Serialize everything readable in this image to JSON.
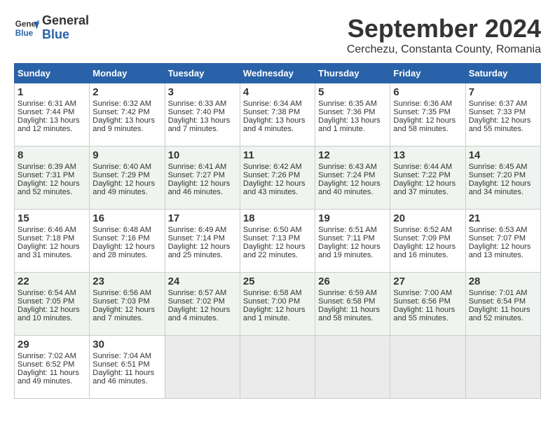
{
  "header": {
    "logo_line1": "General",
    "logo_line2": "Blue",
    "month": "September 2024",
    "location": "Cerchezu, Constanta County, Romania"
  },
  "weekdays": [
    "Sunday",
    "Monday",
    "Tuesday",
    "Wednesday",
    "Thursday",
    "Friday",
    "Saturday"
  ],
  "weeks": [
    [
      {
        "day": "1",
        "sunrise": "Sunrise: 6:31 AM",
        "sunset": "Sunset: 7:44 PM",
        "daylight": "Daylight: 13 hours and 12 minutes."
      },
      {
        "day": "2",
        "sunrise": "Sunrise: 6:32 AM",
        "sunset": "Sunset: 7:42 PM",
        "daylight": "Daylight: 13 hours and 9 minutes."
      },
      {
        "day": "3",
        "sunrise": "Sunrise: 6:33 AM",
        "sunset": "Sunset: 7:40 PM",
        "daylight": "Daylight: 13 hours and 7 minutes."
      },
      {
        "day": "4",
        "sunrise": "Sunrise: 6:34 AM",
        "sunset": "Sunset: 7:38 PM",
        "daylight": "Daylight: 13 hours and 4 minutes."
      },
      {
        "day": "5",
        "sunrise": "Sunrise: 6:35 AM",
        "sunset": "Sunset: 7:36 PM",
        "daylight": "Daylight: 13 hours and 1 minute."
      },
      {
        "day": "6",
        "sunrise": "Sunrise: 6:36 AM",
        "sunset": "Sunset: 7:35 PM",
        "daylight": "Daylight: 12 hours and 58 minutes."
      },
      {
        "day": "7",
        "sunrise": "Sunrise: 6:37 AM",
        "sunset": "Sunset: 7:33 PM",
        "daylight": "Daylight: 12 hours and 55 minutes."
      }
    ],
    [
      {
        "day": "8",
        "sunrise": "Sunrise: 6:39 AM",
        "sunset": "Sunset: 7:31 PM",
        "daylight": "Daylight: 12 hours and 52 minutes."
      },
      {
        "day": "9",
        "sunrise": "Sunrise: 6:40 AM",
        "sunset": "Sunset: 7:29 PM",
        "daylight": "Daylight: 12 hours and 49 minutes."
      },
      {
        "day": "10",
        "sunrise": "Sunrise: 6:41 AM",
        "sunset": "Sunset: 7:27 PM",
        "daylight": "Daylight: 12 hours and 46 minutes."
      },
      {
        "day": "11",
        "sunrise": "Sunrise: 6:42 AM",
        "sunset": "Sunset: 7:26 PM",
        "daylight": "Daylight: 12 hours and 43 minutes."
      },
      {
        "day": "12",
        "sunrise": "Sunrise: 6:43 AM",
        "sunset": "Sunset: 7:24 PM",
        "daylight": "Daylight: 12 hours and 40 minutes."
      },
      {
        "day": "13",
        "sunrise": "Sunrise: 6:44 AM",
        "sunset": "Sunset: 7:22 PM",
        "daylight": "Daylight: 12 hours and 37 minutes."
      },
      {
        "day": "14",
        "sunrise": "Sunrise: 6:45 AM",
        "sunset": "Sunset: 7:20 PM",
        "daylight": "Daylight: 12 hours and 34 minutes."
      }
    ],
    [
      {
        "day": "15",
        "sunrise": "Sunrise: 6:46 AM",
        "sunset": "Sunset: 7:18 PM",
        "daylight": "Daylight: 12 hours and 31 minutes."
      },
      {
        "day": "16",
        "sunrise": "Sunrise: 6:48 AM",
        "sunset": "Sunset: 7:16 PM",
        "daylight": "Daylight: 12 hours and 28 minutes."
      },
      {
        "day": "17",
        "sunrise": "Sunrise: 6:49 AM",
        "sunset": "Sunset: 7:14 PM",
        "daylight": "Daylight: 12 hours and 25 minutes."
      },
      {
        "day": "18",
        "sunrise": "Sunrise: 6:50 AM",
        "sunset": "Sunset: 7:13 PM",
        "daylight": "Daylight: 12 hours and 22 minutes."
      },
      {
        "day": "19",
        "sunrise": "Sunrise: 6:51 AM",
        "sunset": "Sunset: 7:11 PM",
        "daylight": "Daylight: 12 hours and 19 minutes."
      },
      {
        "day": "20",
        "sunrise": "Sunrise: 6:52 AM",
        "sunset": "Sunset: 7:09 PM",
        "daylight": "Daylight: 12 hours and 16 minutes."
      },
      {
        "day": "21",
        "sunrise": "Sunrise: 6:53 AM",
        "sunset": "Sunset: 7:07 PM",
        "daylight": "Daylight: 12 hours and 13 minutes."
      }
    ],
    [
      {
        "day": "22",
        "sunrise": "Sunrise: 6:54 AM",
        "sunset": "Sunset: 7:05 PM",
        "daylight": "Daylight: 12 hours and 10 minutes."
      },
      {
        "day": "23",
        "sunrise": "Sunrise: 6:56 AM",
        "sunset": "Sunset: 7:03 PM",
        "daylight": "Daylight: 12 hours and 7 minutes."
      },
      {
        "day": "24",
        "sunrise": "Sunrise: 6:57 AM",
        "sunset": "Sunset: 7:02 PM",
        "daylight": "Daylight: 12 hours and 4 minutes."
      },
      {
        "day": "25",
        "sunrise": "Sunrise: 6:58 AM",
        "sunset": "Sunset: 7:00 PM",
        "daylight": "Daylight: 12 hours and 1 minute."
      },
      {
        "day": "26",
        "sunrise": "Sunrise: 6:59 AM",
        "sunset": "Sunset: 6:58 PM",
        "daylight": "Daylight: 11 hours and 58 minutes."
      },
      {
        "day": "27",
        "sunrise": "Sunrise: 7:00 AM",
        "sunset": "Sunset: 6:56 PM",
        "daylight": "Daylight: 11 hours and 55 minutes."
      },
      {
        "day": "28",
        "sunrise": "Sunrise: 7:01 AM",
        "sunset": "Sunset: 6:54 PM",
        "daylight": "Daylight: 11 hours and 52 minutes."
      }
    ],
    [
      {
        "day": "29",
        "sunrise": "Sunrise: 7:02 AM",
        "sunset": "Sunset: 6:52 PM",
        "daylight": "Daylight: 11 hours and 49 minutes."
      },
      {
        "day": "30",
        "sunrise": "Sunrise: 7:04 AM",
        "sunset": "Sunset: 6:51 PM",
        "daylight": "Daylight: 11 hours and 46 minutes."
      },
      null,
      null,
      null,
      null,
      null
    ]
  ]
}
